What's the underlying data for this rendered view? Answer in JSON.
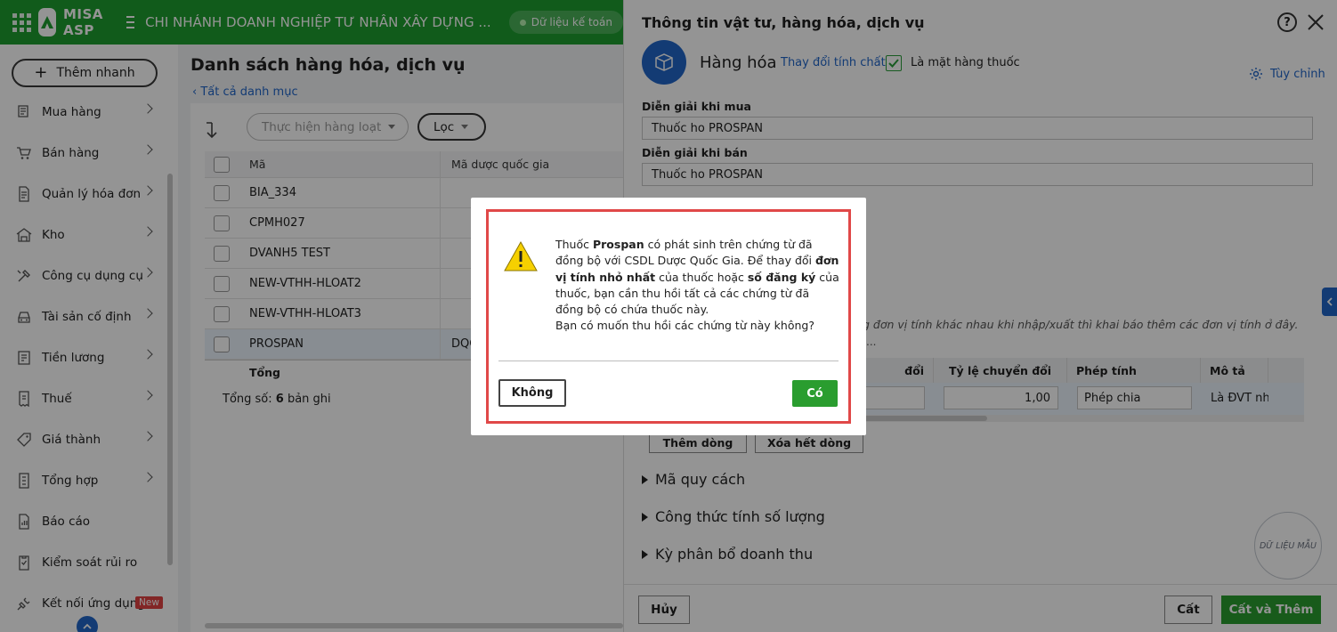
{
  "topbar": {
    "brand": "MISA ASP",
    "branch": "CHI NHÁNH DOANH NGHIỆP TƯ NHÂN XÂY DỰNG ...",
    "data_status": "Dữ liệu kế toán"
  },
  "sidebar": {
    "quick_add": "Thêm nhanh",
    "items": [
      {
        "label": "Mua hàng",
        "icon": "cart-icon"
      },
      {
        "label": "Bán hàng",
        "icon": "shopping-cart-icon"
      },
      {
        "label": "Quản lý hóa đơn",
        "icon": "invoice-icon"
      },
      {
        "label": "Kho",
        "icon": "warehouse-icon"
      },
      {
        "label": "Công cụ dụng cụ",
        "icon": "tools-icon"
      },
      {
        "label": "Tài sản cố định",
        "icon": "car-icon"
      },
      {
        "label": "Tiền lương",
        "icon": "payroll-icon"
      },
      {
        "label": "Thuế",
        "icon": "tax-icon"
      },
      {
        "label": "Giá thành",
        "icon": "price-tag-icon"
      },
      {
        "label": "Tổng hợp",
        "icon": "ledger-icon"
      },
      {
        "label": "Báo cáo",
        "icon": "report-icon"
      },
      {
        "label": "Kiểm soát rủi ro",
        "icon": "checklist-icon"
      },
      {
        "label": "Kết nối ứng dụng",
        "icon": "plug-icon",
        "badge": "New"
      }
    ]
  },
  "main": {
    "title": "Danh sách hàng hóa, dịch vụ",
    "breadcrumb": "Tất cả danh mục",
    "bulk_action": "Thực hiện hàng loạt",
    "filter": "Lọc",
    "columns": [
      "Mã",
      "Mã dược quốc gia"
    ],
    "rows": [
      {
        "ma": "BIA_334",
        "mdqg": ""
      },
      {
        "ma": "CPMH027",
        "mdqg": ""
      },
      {
        "ma": "DVANH5 TEST",
        "mdqg": ""
      },
      {
        "ma": "NEW-VTHH-HLOAT2",
        "mdqg": ""
      },
      {
        "ma": "NEW-VTHH-HLOAT3",
        "mdqg": ""
      },
      {
        "ma": "PROSPAN",
        "mdqg": "DQG"
      }
    ],
    "total_label": "Tổng",
    "count_prefix": "Tổng số:",
    "count_value": "6",
    "count_suffix": "bản ghi"
  },
  "panel": {
    "title": "Thông tin vật tư, hàng hóa, dịch vụ",
    "help": "?",
    "item_type": "Hàng hóa",
    "change_nature": "Thay đổi tính chất",
    "is_drug_label": "Là mặt hàng thuốc",
    "is_drug_checked": true,
    "customize": "Tùy chỉnh",
    "purchase_desc_label": "Diễn giải khi mua",
    "purchase_desc": "Thuốc ho PROSPAN",
    "sale_desc_label": "Diễn giải khi bán",
    "sale_desc": "Thuốc ho PROSPAN",
    "conversion_hint": "g đơn vị tính khác nhau khi nhập/xuất thì khai báo thêm các đơn vị tính ở đây.",
    "conversion_hint2": "...",
    "conv_columns": [
      "đổi",
      "Tỷ lệ chuyển đổi",
      "Phép tính",
      "Mô tả"
    ],
    "conv_row": {
      "rate": "1,00",
      "operation": "Phép chia",
      "desc": "Là ĐVT nhỏ"
    },
    "add_row": "Thêm dòng",
    "delete_rows": "Xóa hết dòng",
    "sections": [
      "Mã quy cách",
      "Công thức tính số lượng",
      "Kỳ phân bổ doanh thu"
    ],
    "stamp": "DỮ LIỆU MẪU",
    "cancel": "Hủy",
    "save": "Cất",
    "save_add": "Cất và Thêm"
  },
  "dialog": {
    "t1": "Thuốc ",
    "b1": "Prospan",
    "t2": " có phát sinh trên chứng từ đã đồng bộ với CSDL Dược Quốc Gia. Để thay đổi ",
    "b2": "đơn vị tính nhỏ nhất",
    "t3": " của thuốc hoặc ",
    "b3": "số đăng ký",
    "t4": " của thuốc, bạn cần thu hồi tất cả các chứng từ đã đồng bộ có chứa thuốc này.",
    "question": "Bạn có muốn thu hồi các chứng từ này không?",
    "no": "Không",
    "yes": "Có"
  },
  "colors": {
    "brand_green": "#1e9e2f",
    "primary_blue": "#2166c9",
    "confirm_green": "#2a9d2f",
    "highlight_red": "#e04848"
  }
}
